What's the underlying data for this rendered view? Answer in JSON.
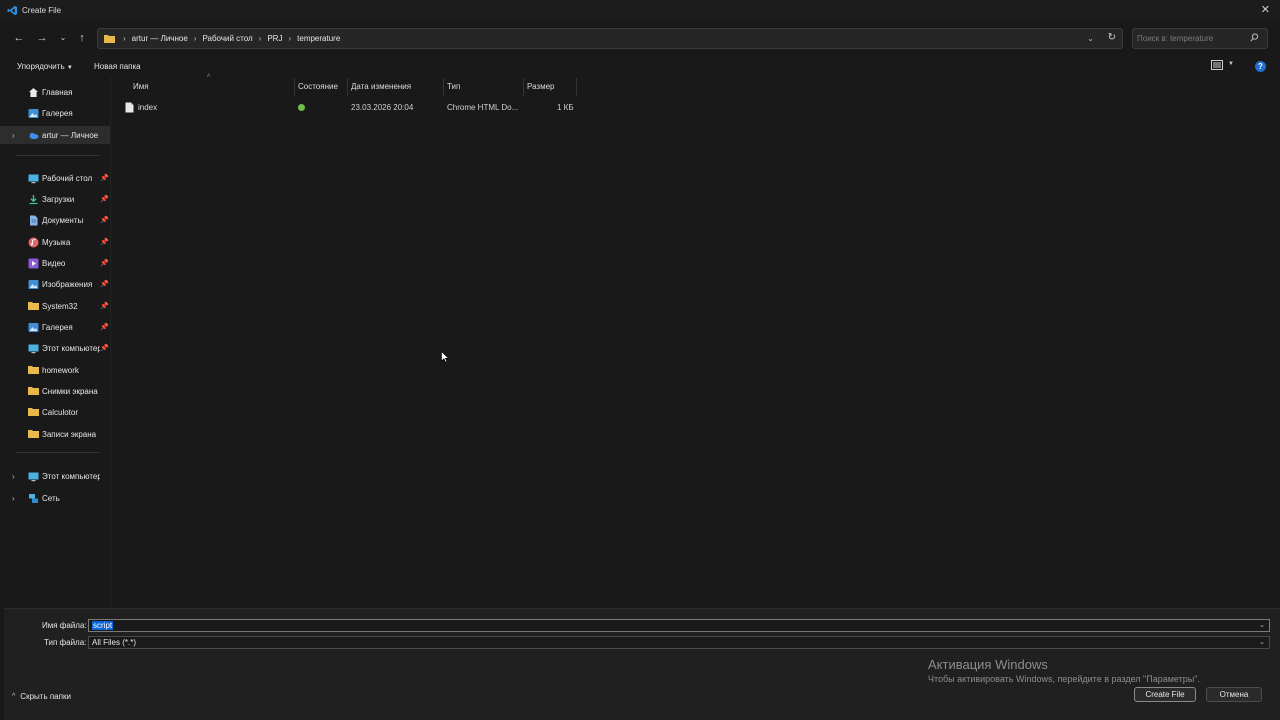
{
  "window": {
    "title": "Create File"
  },
  "address": {
    "crumbs": [
      "artur — Личное",
      "Рабочий стол",
      "PRJ",
      "temperature"
    ]
  },
  "search": {
    "placeholder": "Поиск в: temperature"
  },
  "toolbar": {
    "organize_label": "Упорядочить",
    "new_folder_label": "Новая папка"
  },
  "sidebar": {
    "quick": [
      {
        "label": "Главная",
        "icon": "home-icon"
      },
      {
        "label": "Галерея",
        "icon": "gallery-icon"
      },
      {
        "label": "artur — Личное",
        "icon": "onedrive-icon"
      }
    ],
    "pinned": [
      {
        "label": "Рабочий стол",
        "icon": "desktop-icon"
      },
      {
        "label": "Загрузки",
        "icon": "download-icon"
      },
      {
        "label": "Документы",
        "icon": "documents-icon"
      },
      {
        "label": "Музыка",
        "icon": "music-icon"
      },
      {
        "label": "Видео",
        "icon": "video-icon"
      },
      {
        "label": "Изображения",
        "icon": "pictures-icon"
      },
      {
        "label": "System32",
        "icon": "folder-icon"
      },
      {
        "label": "Галерея",
        "icon": "gallery-icon"
      },
      {
        "label": "Этот компьютер",
        "icon": "computer-icon"
      },
      {
        "label": "homework",
        "icon": "folder-icon"
      },
      {
        "label": "Снимки экрана",
        "icon": "folder-icon"
      },
      {
        "label": "Calculotor",
        "icon": "folder-icon"
      },
      {
        "label": "Записи экрана",
        "icon": "folder-icon"
      }
    ],
    "bottom": [
      {
        "label": "Этот компьютер",
        "icon": "computer-icon"
      },
      {
        "label": "Сеть",
        "icon": "network-icon"
      }
    ]
  },
  "columns": {
    "name": "Имя",
    "status": "Состояние",
    "modified": "Дата изменения",
    "type": "Тип",
    "size": "Размер"
  },
  "files": [
    {
      "name": "index",
      "status": "synced",
      "modified": "23.03.2026 20:04",
      "type": "Chrome HTML Do...",
      "size": "1 КБ"
    }
  ],
  "form": {
    "filename_label": "Имя файла:",
    "filename_value": "script",
    "filetype_label": "Тип файла:",
    "filetype_value": "All Files (*.*)"
  },
  "activation": {
    "title": "Активация Windows",
    "text": "Чтобы активировать Windows, перейдите в раздел \"Параметры\"."
  },
  "buttons": {
    "create": "Create File",
    "cancel": "Отмена",
    "hide_folders": "Скрыть папки"
  },
  "colors": {
    "accent": "#0a64d8",
    "background": "#191919",
    "panel": "#202020"
  }
}
